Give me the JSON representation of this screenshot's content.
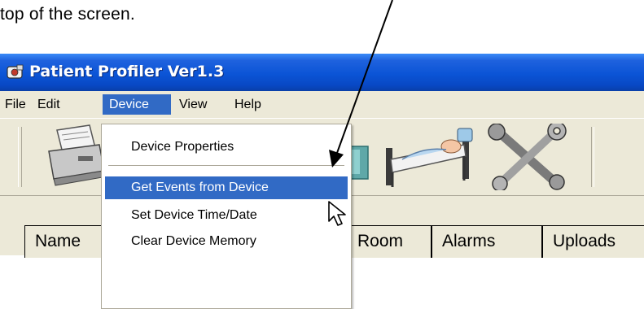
{
  "caption": "top of the screen.",
  "window": {
    "title": "Patient Profiler Ver1.3",
    "titlebar_color": "#0b54d6"
  },
  "menubar": {
    "items": [
      "File",
      "Edit",
      "Device",
      "View",
      "Help"
    ],
    "active": "Device",
    "highlight_color": "#316ac5"
  },
  "device_menu": {
    "items": [
      "Device Properties",
      "Get Events from Device",
      "Set Device Time/Date",
      "Clear Device Memory"
    ],
    "highlighted": "Get Events from Device"
  },
  "toolbar": {
    "icons": [
      "printer-icon",
      "bed-icon",
      "tools-icon"
    ]
  },
  "list_columns": [
    "Name",
    "Room",
    "Alarms",
    "Uploads"
  ]
}
